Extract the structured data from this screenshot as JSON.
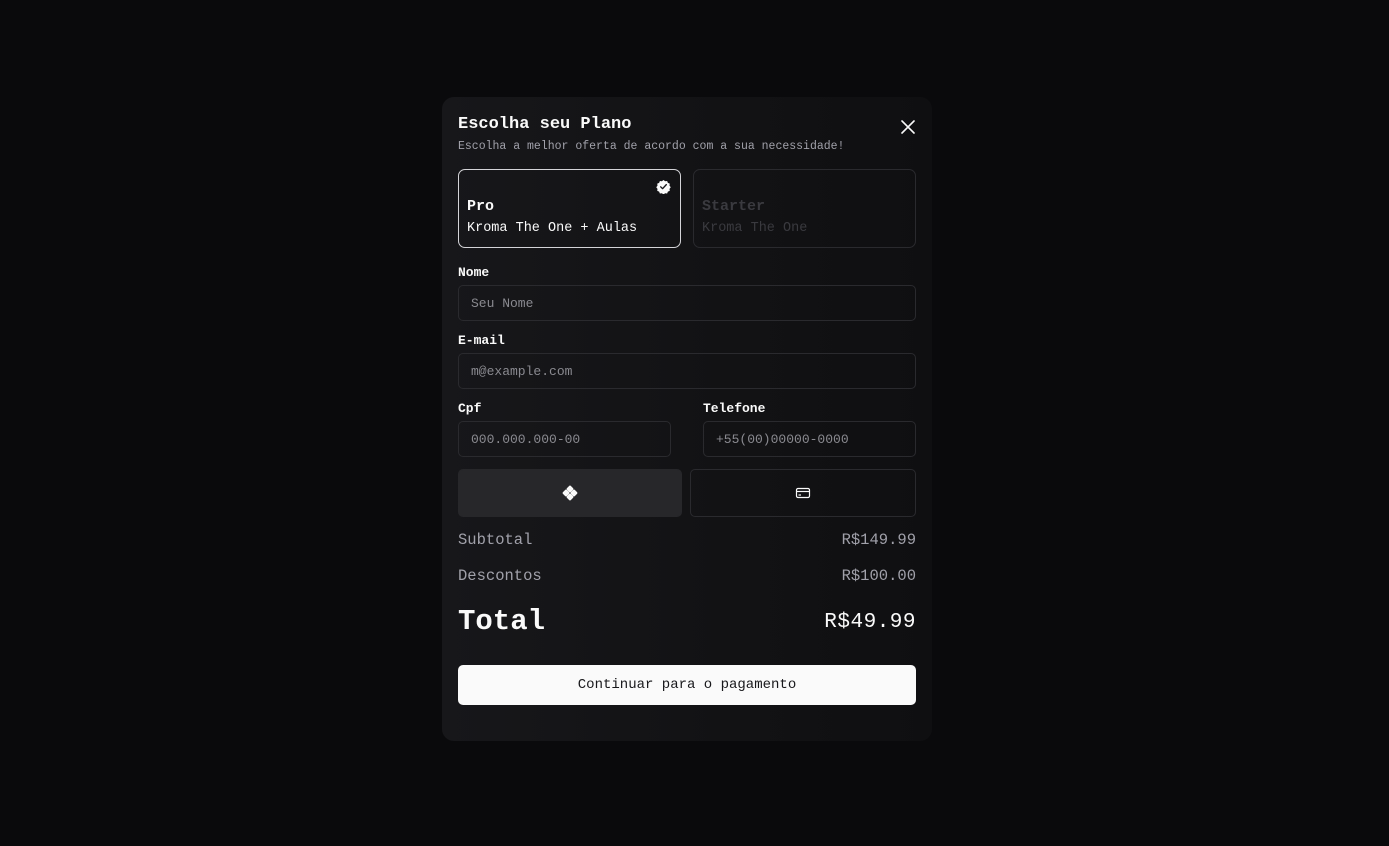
{
  "modal": {
    "title": "Escolha seu Plano",
    "subtitle": "Escolha a melhor oferta de acordo com a sua necessidade!",
    "close_icon": "close-icon"
  },
  "plans": [
    {
      "name": "Pro",
      "description": "Kroma The One + Aulas",
      "selected": true
    },
    {
      "name": "Starter",
      "description": "Kroma The One",
      "selected": false
    }
  ],
  "form": {
    "name": {
      "label": "Nome",
      "placeholder": "Seu Nome"
    },
    "email": {
      "label": "E-mail",
      "placeholder": "m@example.com"
    },
    "cpf": {
      "label": "Cpf",
      "placeholder": "000.000.000-00"
    },
    "phone": {
      "label": "Telefone",
      "placeholder": "+55(00)00000-0000"
    }
  },
  "payment_methods": [
    {
      "icon": "pix-icon",
      "selected": true
    },
    {
      "icon": "credit-card-icon",
      "selected": false
    }
  ],
  "summary": {
    "subtotal_label": "Subtotal",
    "subtotal_value": "R$149.99",
    "discount_label": "Descontos",
    "discount_value": "R$100.00",
    "total_label": "Total",
    "total_value": "R$49.99"
  },
  "continue_label": "Continuar para o pagamento",
  "colors": {
    "background": "#0a0a0c",
    "modal": "#141416",
    "accent_button": "#fafafa",
    "border": "#2a2a2e"
  }
}
